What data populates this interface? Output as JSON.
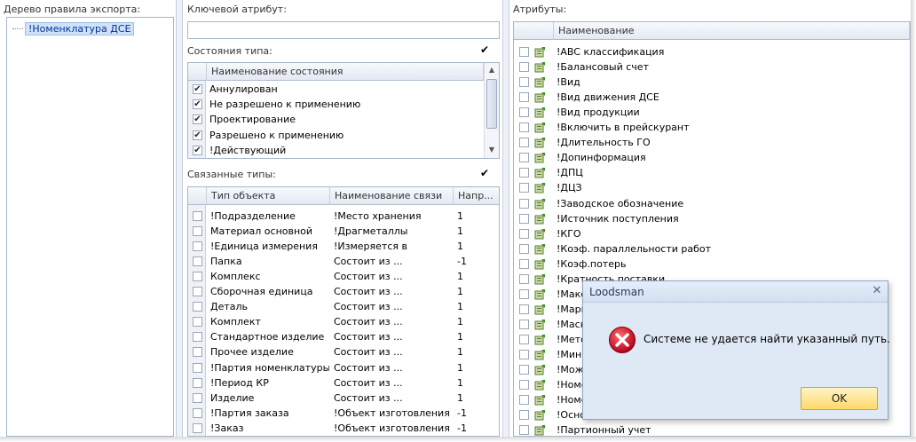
{
  "tree": {
    "label": "Дерево правила экспорта:",
    "node": "!Номенклатура ДСЕ"
  },
  "key_attr": {
    "label": "Ключевой атрибут:",
    "value": ""
  },
  "states": {
    "label": "Состояния типа:",
    "header": "Наименование состояния",
    "rows": [
      {
        "name": "Аннулирован",
        "checked": true
      },
      {
        "name": "Не разрешено к применению",
        "checked": true
      },
      {
        "name": "Проектирование",
        "checked": true
      },
      {
        "name": "Разрешено к применению",
        "checked": true
      },
      {
        "name": "!Действующий",
        "checked": true
      }
    ]
  },
  "linked": {
    "label": "Связанные типы:",
    "headers": [
      "Тип объекта",
      "Наименование связи",
      "Напр..."
    ],
    "rows": [
      {
        "type": "!Подразделение",
        "link": "!Место хранения",
        "dir": "1"
      },
      {
        "type": "Материал основной",
        "link": "!Драгметаллы",
        "dir": "1"
      },
      {
        "type": "!Единица измерения",
        "link": "!Измеряется в",
        "dir": "1"
      },
      {
        "type": "Папка",
        "link": "Состоит из ...",
        "dir": "-1"
      },
      {
        "type": "Комплекс",
        "link": "Состоит из ...",
        "dir": "1"
      },
      {
        "type": "Сборочная единица",
        "link": "Состоит из ...",
        "dir": "1"
      },
      {
        "type": "Деталь",
        "link": "Состоит из ...",
        "dir": "1"
      },
      {
        "type": "Комплект",
        "link": "Состоит из ...",
        "dir": "1"
      },
      {
        "type": "Стандартное изделие",
        "link": "Состоит из ...",
        "dir": "1"
      },
      {
        "type": "Прочее изделие",
        "link": "Состоит из ...",
        "dir": "1"
      },
      {
        "type": "!Партия номенклатуры",
        "link": "Состоит из ...",
        "dir": "1"
      },
      {
        "type": "!Период КР",
        "link": "Состоит из ...",
        "dir": "1"
      },
      {
        "type": "Изделие",
        "link": "Состоит из ...",
        "dir": "1"
      },
      {
        "type": "!Партия заказа",
        "link": "!Объект изготовления",
        "dir": "-1"
      },
      {
        "type": "!Заказ",
        "link": "!Объект изготовления",
        "dir": "-1"
      }
    ]
  },
  "attrs": {
    "label": "Атрибуты:",
    "header": "Наименование",
    "rows": [
      "!ABC классификация",
      "!Балансовый счет",
      "!Вид",
      "!Вид движения ДСЕ",
      "!Вид продукции",
      "!Включить в прейскурант",
      "!Длительность ГО",
      "!Допинформация",
      "!ДПЦ",
      "!ДЦЗ",
      "!Заводское обозначение",
      "!Источник поступления",
      "!КГО",
      "!Коэф. параллельности работ",
      "!Коэф.потерь",
      "!Кратность поставки",
      "!Макс",
      "!Марк",
      "!Маск",
      "!Мето",
      "!Мини",
      "!Може",
      "!Номе",
      "!Номе",
      "!Осно",
      "!Партионный учет"
    ]
  },
  "dialog": {
    "title": "Loodsman",
    "message": "Системе не удается найти указанный путь.",
    "ok": "OK"
  },
  "colors": {
    "selection": "#cfe2f8",
    "dialog_bg": "#dfe9f5",
    "ok_button": "#ffd96a",
    "error_icon": "#c8102e"
  }
}
